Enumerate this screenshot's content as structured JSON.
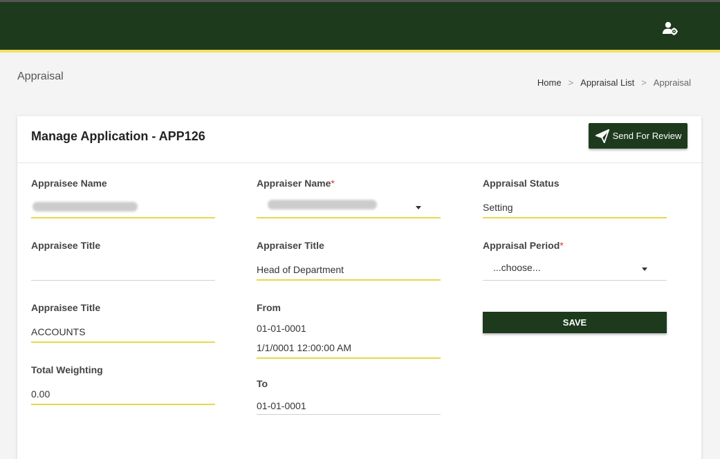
{
  "page_title": "Appraisal",
  "breadcrumb": [
    "Home",
    "Appraisal List",
    "Appraisal"
  ],
  "card": {
    "title": "Manage Application - APP126",
    "review_button": "Send For Review"
  },
  "fields": {
    "appraisee_name": {
      "label": "Appraisee Name"
    },
    "appraiser_name": {
      "label": "Appraiser Name",
      "required": "*"
    },
    "appraisal_status": {
      "label": "Appraisal Status",
      "value": "Setting"
    },
    "appraisee_title": {
      "label": "Appraisee Title",
      "value": ""
    },
    "appraiser_title": {
      "label": "Appraiser Title",
      "value": "Head of Department"
    },
    "appraisal_period": {
      "label": "Appraisal Period",
      "required": "*",
      "value": "...choose..."
    },
    "appraisee_title2": {
      "label": "Appraisee Title",
      "value": "ACCOUNTS"
    },
    "from": {
      "label": "From",
      "date": "01-01-0001",
      "datetime": "1/1/0001 12:00:00 AM"
    },
    "total_weighting": {
      "label": "Total Weighting",
      "value": "0.00"
    },
    "to": {
      "label": "To",
      "date": "01-01-0001"
    }
  },
  "save_label": "SAVE",
  "colors": {
    "primary": "#1d3a1d",
    "accent": "#e8d84a"
  },
  "icons": {
    "user_settings": "user-gear-icon",
    "send": "paper-plane-icon"
  }
}
